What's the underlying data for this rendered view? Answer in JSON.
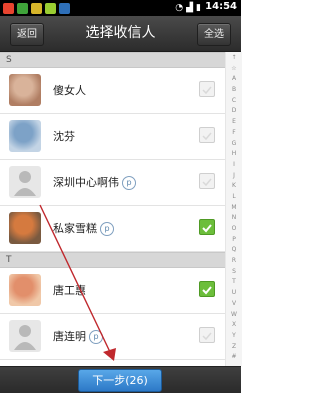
{
  "statusbar": {
    "time": "14:54"
  },
  "header": {
    "back_label": "返回",
    "title": "选择收信人",
    "select_all_label": "全选"
  },
  "sections": [
    {
      "letter": "S",
      "contacts": [
        {
          "name": "傻女人",
          "checked": false,
          "avatar": "photo",
          "has_badge": false
        },
        {
          "name": "沈芬",
          "checked": false,
          "avatar": "photo",
          "has_badge": false
        },
        {
          "name": "深圳中心啊伟",
          "checked": false,
          "avatar": "default",
          "has_badge": true
        },
        {
          "name": "私家雪糕",
          "checked": true,
          "avatar": "photo",
          "has_badge": true
        }
      ]
    },
    {
      "letter": "T",
      "contacts": [
        {
          "name": "唐工惠",
          "checked": true,
          "avatar": "photo",
          "has_badge": false
        },
        {
          "name": "唐连明",
          "checked": false,
          "avatar": "default",
          "has_badge": true
        }
      ]
    }
  ],
  "index_letters": [
    "↑",
    "☆",
    "A",
    "B",
    "C",
    "D",
    "E",
    "F",
    "G",
    "H",
    "I",
    "J",
    "K",
    "L",
    "M",
    "N",
    "O",
    "P",
    "Q",
    "R",
    "S",
    "T",
    "U",
    "V",
    "W",
    "X",
    "Y",
    "Z",
    "#"
  ],
  "footer": {
    "next_label": "下一步(26)"
  },
  "colors": {
    "checked": "#6cbe3b",
    "accent_button": "#2d79c7",
    "annotation_arrow": "#c0282d"
  }
}
